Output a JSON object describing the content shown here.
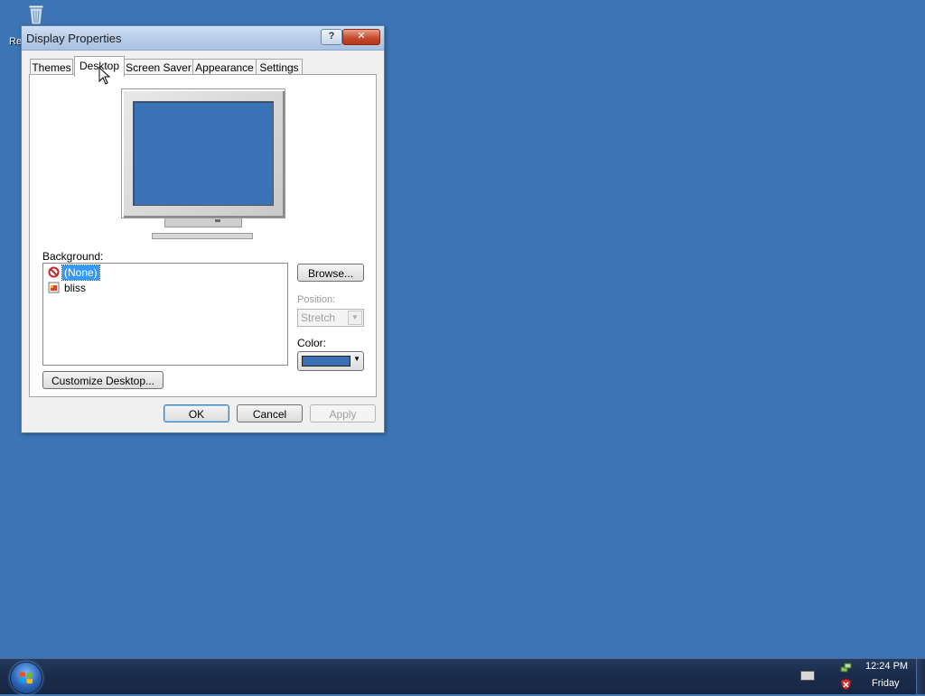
{
  "desktop": {
    "recycle_bin_label": "Re",
    "background_color": "#3b75b5"
  },
  "window": {
    "title": "Display Properties",
    "help_label": "?",
    "close_label": "✕",
    "tabs": [
      {
        "label": "Themes"
      },
      {
        "label": "Desktop",
        "active": true
      },
      {
        "label": "Screen Saver"
      },
      {
        "label": "Appearance"
      },
      {
        "label": "Settings"
      }
    ],
    "background_label": "Background:",
    "background_items": [
      {
        "label": "(None)",
        "icon": "no-symbol-icon",
        "selected": true
      },
      {
        "label": "bliss",
        "icon": "image-file-icon",
        "selected": false
      }
    ],
    "browse_label": "Browse...",
    "position_label": "Position:",
    "position_value": "Stretch",
    "color_label": "Color:",
    "color_value": "#3a6fb3",
    "customize_label": "Customize Desktop...",
    "ok_label": "OK",
    "cancel_label": "Cancel",
    "apply_label": "Apply"
  },
  "taskbar": {
    "clock_time": "12:24 PM",
    "clock_day": "Friday"
  }
}
